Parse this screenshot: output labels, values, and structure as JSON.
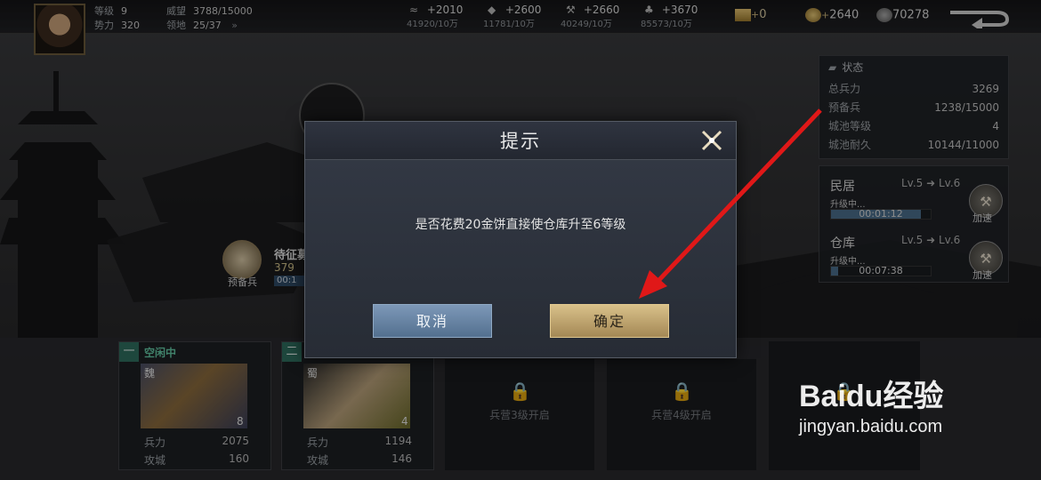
{
  "player": {
    "level_label": "等级",
    "level": "9",
    "power_label": "势力",
    "power": "320",
    "prestige_label": "威望",
    "prestige": "3788/15000",
    "territory_label": "领地",
    "territory": "25/37",
    "territory_arrow": "»"
  },
  "resources": [
    {
      "icon": "wood-icon",
      "gain": "+2010",
      "sub": "41920/10万"
    },
    {
      "icon": "stone-icon",
      "gain": "+2600",
      "sub": "11781/10万"
    },
    {
      "icon": "iron-icon",
      "gain": "+2660",
      "sub": "40249/10万"
    },
    {
      "icon": "grain-icon",
      "gain": "+3670",
      "sub": "85573/10万"
    }
  ],
  "currency": {
    "gold_bars": "0",
    "gold_bars_plus": "+",
    "coins": "2640",
    "coins_plus": "+",
    "copper": "70278"
  },
  "status_panel": {
    "title": "状态",
    "rows": [
      {
        "label": "总兵力",
        "value": "3269"
      },
      {
        "label": "预备兵",
        "value": "1238/15000"
      },
      {
        "label": "城池等级",
        "value": "4"
      },
      {
        "label": "城池耐久",
        "value": "10144/11000"
      }
    ]
  },
  "upgrades": [
    {
      "name": "民居",
      "from": "Lv.5",
      "to": "Lv.6",
      "status": "升级中...",
      "time": "00:01:12",
      "progress": 0.9,
      "action": "加速"
    },
    {
      "name": "仓库",
      "from": "Lv.5",
      "to": "Lv.6",
      "status": "升级中...",
      "time": "00:07:38",
      "progress": 0.07,
      "action": "加速"
    }
  ],
  "reserve": {
    "title": "待征募",
    "count": "379",
    "label": "预备兵",
    "timer_partial": "00:1"
  },
  "modal": {
    "title": "提示",
    "message": "是否花费20金饼直接使仓库升至6等级",
    "cancel": "取消",
    "confirm": "确定"
  },
  "troops": [
    {
      "slot": "一",
      "state": "空闲中",
      "faction": "魏",
      "level": "8",
      "troops_label": "兵力",
      "troops": "2075",
      "siege_label": "攻城",
      "siege": "160"
    },
    {
      "slot": "二",
      "faction": "蜀",
      "level": "4",
      "troops_label": "兵力",
      "troops": "1194",
      "siege_label": "攻城",
      "siege": "146"
    }
  ],
  "locked_slots": [
    {
      "label": "兵营3级开启"
    },
    {
      "label": "兵营4级开启"
    }
  ],
  "watermark": {
    "brand": "Baidu经验",
    "url": "jingyan.baidu.com"
  }
}
